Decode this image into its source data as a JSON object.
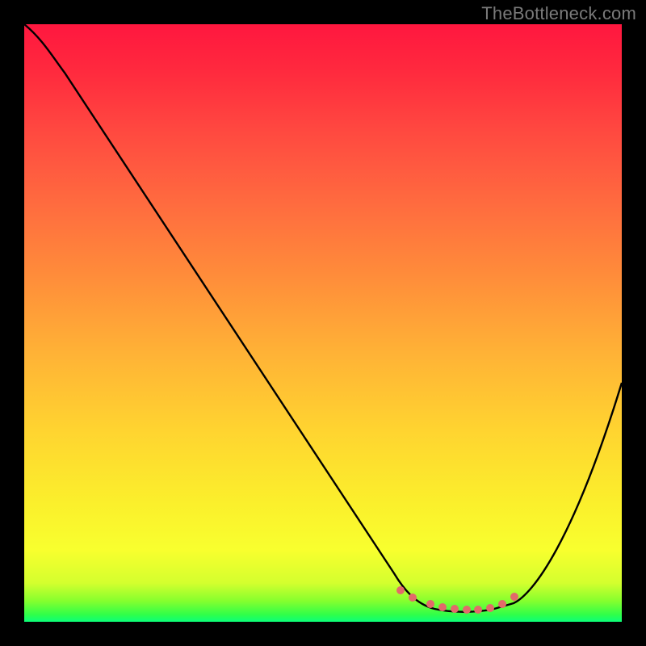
{
  "watermark": "TheBottleneck.com",
  "chart_data": {
    "type": "line",
    "title": "",
    "xlabel": "",
    "ylabel": "",
    "xlim": [
      0,
      100
    ],
    "ylim": [
      0,
      100
    ],
    "grid": false,
    "legend": false,
    "series": [
      {
        "name": "bottleneck-curve",
        "x": [
          0,
          5,
          10,
          20,
          30,
          40,
          50,
          58,
          62,
          67,
          72,
          76,
          78,
          84,
          90,
          100
        ],
        "values": [
          100,
          97,
          92,
          80,
          67,
          54,
          41,
          28,
          18,
          8,
          3,
          2,
          2,
          4,
          14,
          40
        ]
      },
      {
        "name": "highlight-dots",
        "type": "scatter",
        "x": [
          63,
          65,
          68,
          70,
          72,
          74,
          76,
          78,
          80,
          82
        ],
        "values": [
          5.2,
          4.0,
          3.0,
          2.5,
          2.2,
          2.0,
          2.0,
          2.3,
          3.0,
          4.2
        ]
      }
    ],
    "gradient_stops": [
      {
        "pos": 0.0,
        "color": "#ff173f"
      },
      {
        "pos": 0.08,
        "color": "#ff2a3e"
      },
      {
        "pos": 0.18,
        "color": "#ff4940"
      },
      {
        "pos": 0.3,
        "color": "#ff6b3f"
      },
      {
        "pos": 0.42,
        "color": "#ff8c3a"
      },
      {
        "pos": 0.55,
        "color": "#ffb236"
      },
      {
        "pos": 0.68,
        "color": "#ffd430"
      },
      {
        "pos": 0.8,
        "color": "#fbef2c"
      },
      {
        "pos": 0.88,
        "color": "#f8ff2e"
      },
      {
        "pos": 0.935,
        "color": "#d4ff2e"
      },
      {
        "pos": 0.965,
        "color": "#86ff2e"
      },
      {
        "pos": 0.988,
        "color": "#30ff49"
      },
      {
        "pos": 1.0,
        "color": "#0cff79"
      }
    ],
    "colors": {
      "curve_stroke": "#000000",
      "dot_fill": "#e26a6a",
      "background_outer": "#000000"
    }
  }
}
